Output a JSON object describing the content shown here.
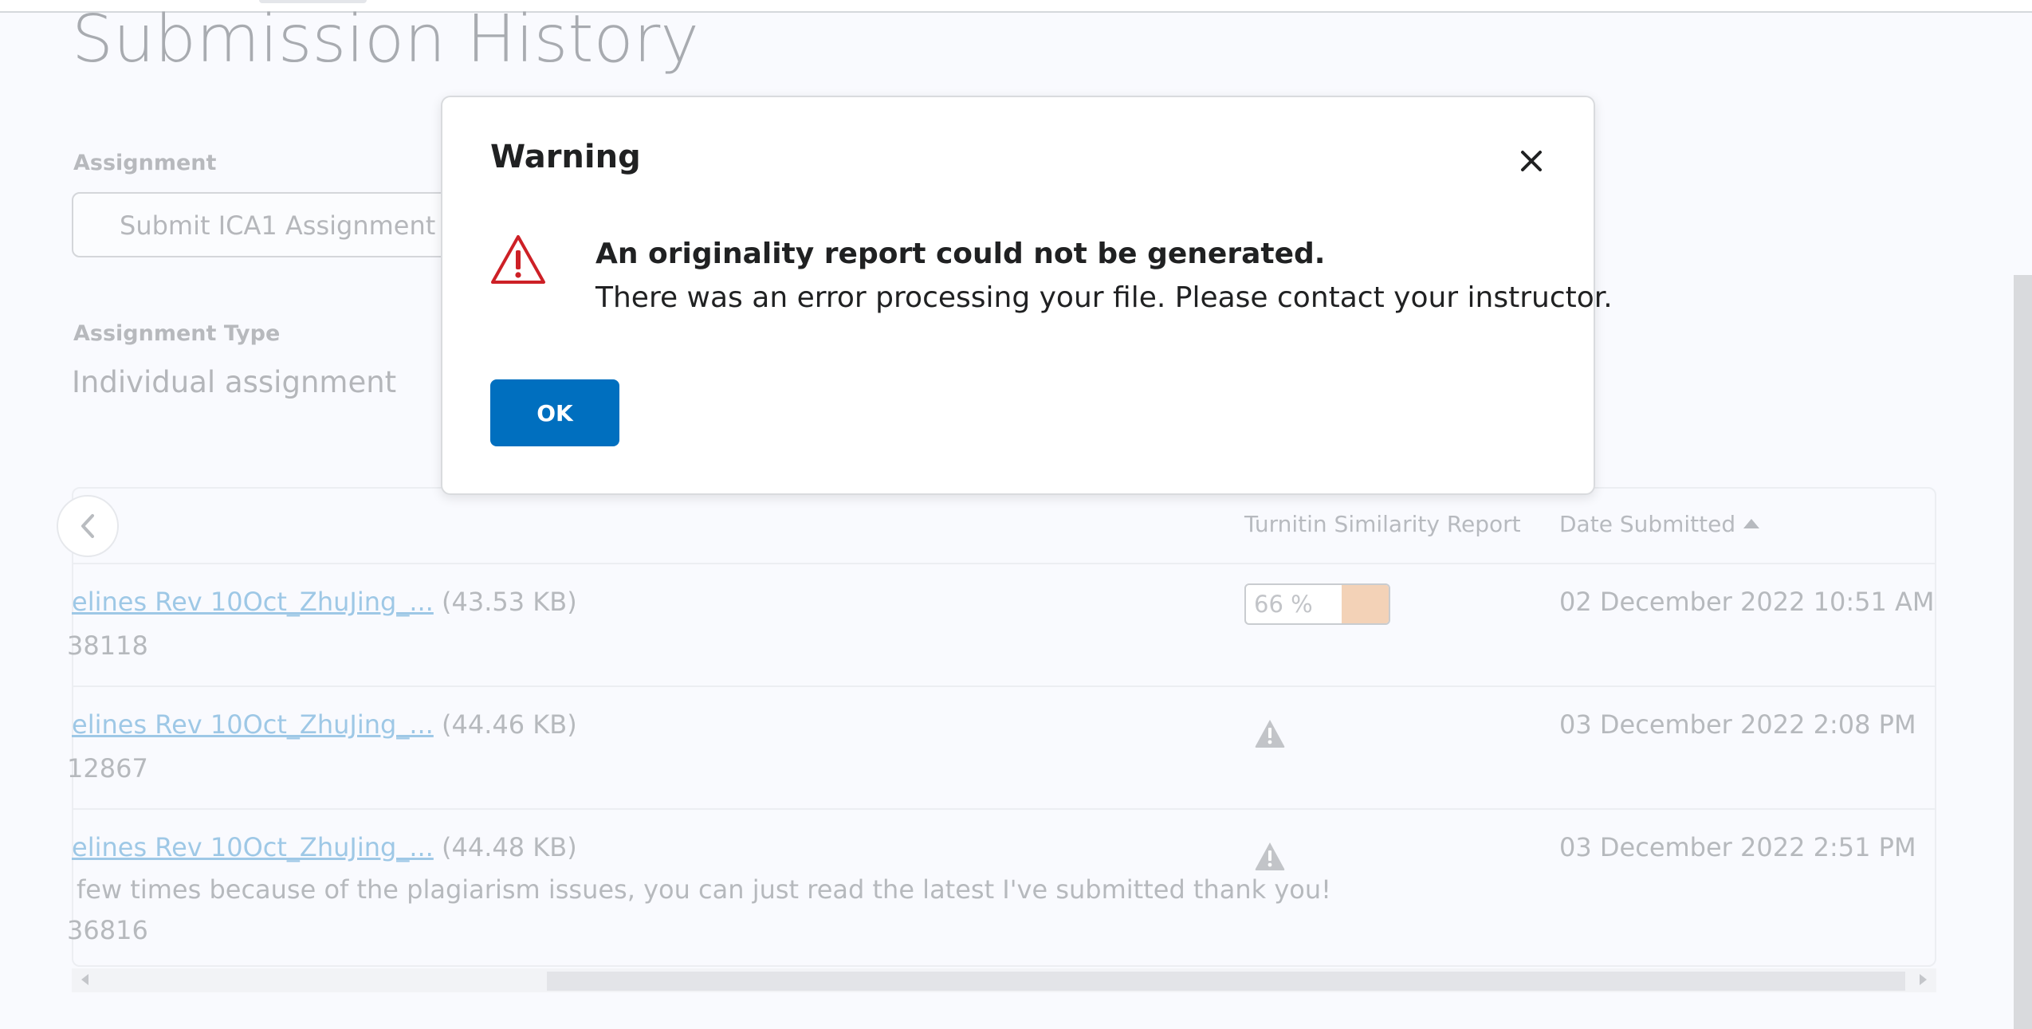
{
  "page": {
    "title": "Submission History",
    "assignment_label": "Assignment",
    "assignment_value": "Submit ICA1 Assignment",
    "type_label": "Assignment Type",
    "type_value": "Individual assignment"
  },
  "table": {
    "columns": {
      "similarity": "Turnitin Similarity Report",
      "date": "Date Submitted",
      "date_sort": "ascending"
    },
    "rows": [
      {
        "file_link": "elines Rev 10Oct_ZhuJing_...",
        "file_size": "(43.53 KB)",
        "comment": "",
        "id_fragment": "38118",
        "similarity": "66 %",
        "similarity_fraction": 0.66,
        "similarity_color": "#f3d2b7",
        "date": "02 December 2022 10:51 AM"
      },
      {
        "file_link": "elines Rev 10Oct_ZhuJing_...",
        "file_size": "(44.46 KB)",
        "comment": "",
        "id_fragment": "12867",
        "similarity_icon": "warning-icon",
        "date": "03 December 2022 2:08 PM"
      },
      {
        "file_link": "elines Rev 10Oct_ZhuJing_...",
        "file_size": "(44.48 KB)",
        "comment": "few times because of the plagiarism issues, you can just read the latest I've submitted thank you!",
        "id_fragment": "36816",
        "similarity_icon": "warning-icon",
        "date": "03 December 2022 2:51 PM"
      }
    ]
  },
  "dialog": {
    "title": "Warning",
    "close_icon": "close-icon",
    "warning_icon": "warning-triangle-icon",
    "heading": "An originality report could not be generated.",
    "message": "There was an error processing your file. Please contact your instructor.",
    "ok_label": "OK"
  },
  "colors": {
    "primary": "#006fbf",
    "warning": "#cd2026",
    "link": "#9ec8e6"
  }
}
